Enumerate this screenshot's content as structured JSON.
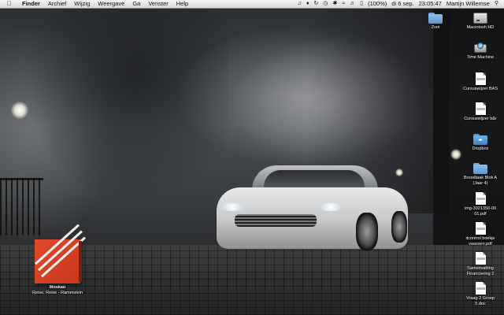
{
  "menubar": {
    "apple_label": "",
    "menus": [
      "Finder",
      "Archief",
      "Wijzig",
      "Weergave",
      "Ga",
      "Venster",
      "Help"
    ],
    "status": {
      "battery": "(100%)",
      "date": "di 6 sep.",
      "time": "23:05:47",
      "user": "Martijn Willemse"
    },
    "status_icons": [
      "music-icon",
      "evernote-icon",
      "sync-icon",
      "time-machine-icon",
      "bluetooth-icon",
      "wifi-icon",
      "volume-icon",
      "battery-icon",
      "spotlight-icon"
    ]
  },
  "desktop_icons": [
    {
      "name": "Zooi",
      "type": "folder"
    },
    {
      "name": "Macintosh HD",
      "type": "drive"
    },
    {
      "name": "Time Machine",
      "type": "time-machine"
    },
    {
      "name": "Cursuswijzer BAS",
      "type": "document"
    },
    {
      "name": "Cursuswijzer b&r",
      "type": "document"
    },
    {
      "name": "Dropbox",
      "type": "dropbox-folder"
    },
    {
      "name": "Broodtaak Blok A",
      "sub": "(Jaar 4)",
      "type": "folder"
    },
    {
      "name": "img-3021350-00",
      "sub": "01.pdf",
      "type": "document"
    },
    {
      "name": "itcontrol boekje",
      "sub": "vaassen.pdf",
      "type": "document"
    },
    {
      "name": "Samenvatting",
      "sub": "Financiering 2",
      "type": "document"
    },
    {
      "name": "Vraag 2 Groep",
      "sub": "5.doc",
      "type": "document"
    }
  ],
  "book_icon": {
    "name": "Moskau",
    "sub": "Reise, Reise - Rammstein"
  },
  "colors": {
    "menubar": "#e6e6e6",
    "folder": "#6fa6d8",
    "book_red": "#d63f22"
  }
}
